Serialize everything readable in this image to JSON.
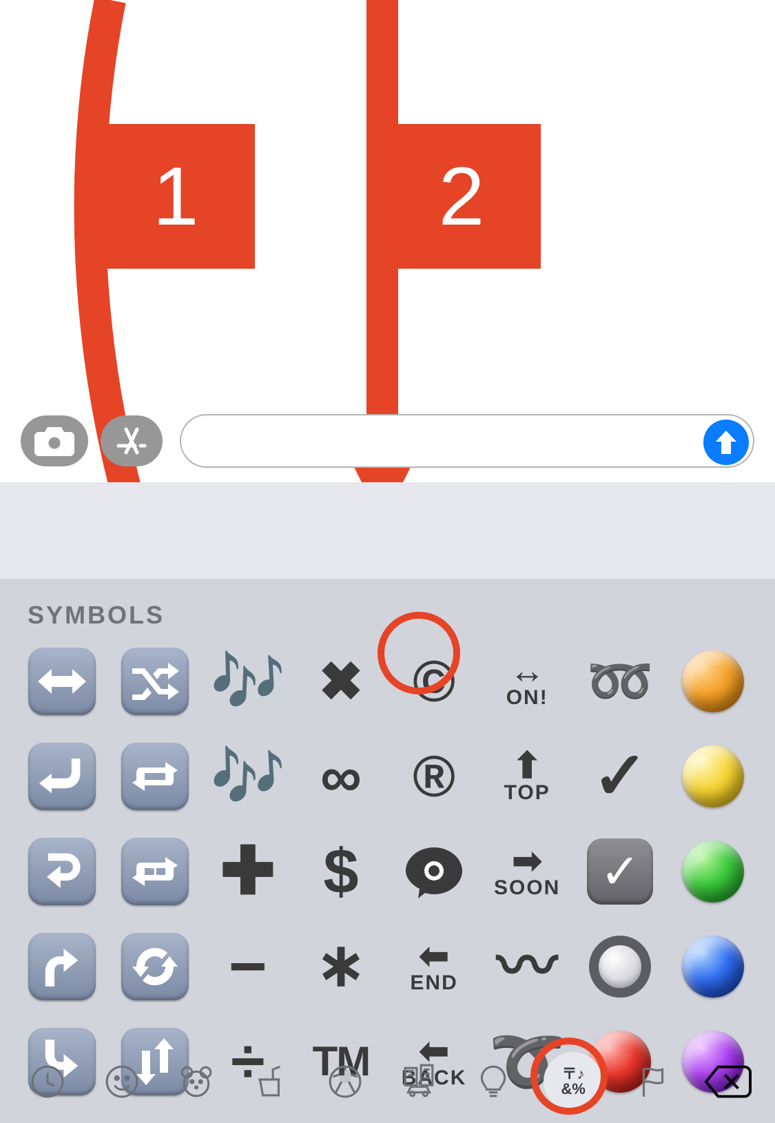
{
  "annotations": {
    "step1_label": "1",
    "step2_label": "2",
    "color": "#e64427"
  },
  "input_row": {
    "camera_icon": "camera-icon",
    "apps_icon": "appstore-icon",
    "text_value": "",
    "send_icon": "arrow-up-icon"
  },
  "keyboard": {
    "section_title": "SYMBOLS",
    "rows": [
      [
        "↔️",
        "🔀",
        "🎶",
        "✖️",
        "©️",
        "↔ ON!",
        "➿",
        "🟠"
      ],
      [
        "↩️",
        "🔁",
        "🎶",
        "♾️",
        "®️",
        "🔝",
        "✔️",
        "🟡"
      ],
      [
        "↪️",
        "🔂",
        "➕",
        "💲",
        "👁️‍🗨️",
        "🔜",
        "☑️",
        "🟢"
      ],
      [
        "⤴️",
        "🔄",
        "➖",
        "*",
        "⬅ END",
        "〰️",
        "⚪",
        "🔵"
      ],
      [
        "⤵️",
        "🔃",
        "➗",
        "™️",
        "🔙",
        "➰",
        "🔴",
        "🟣"
      ]
    ],
    "categories": [
      {
        "id": "recent",
        "icon": "clock-icon"
      },
      {
        "id": "smileys",
        "icon": "smiley-icon"
      },
      {
        "id": "animals",
        "icon": "bear-icon"
      },
      {
        "id": "food",
        "icon": "burger-icon"
      },
      {
        "id": "activity",
        "icon": "soccer-icon"
      },
      {
        "id": "travel",
        "icon": "city-car-icon"
      },
      {
        "id": "objects",
        "icon": "lightbulb-icon"
      },
      {
        "id": "symbols",
        "icon": "symbols-icon",
        "selected": true,
        "label_top": "〒♪",
        "label_bottom": "&%"
      },
      {
        "id": "flags",
        "icon": "flag-icon"
      }
    ],
    "delete_icon": "delete-icon"
  }
}
